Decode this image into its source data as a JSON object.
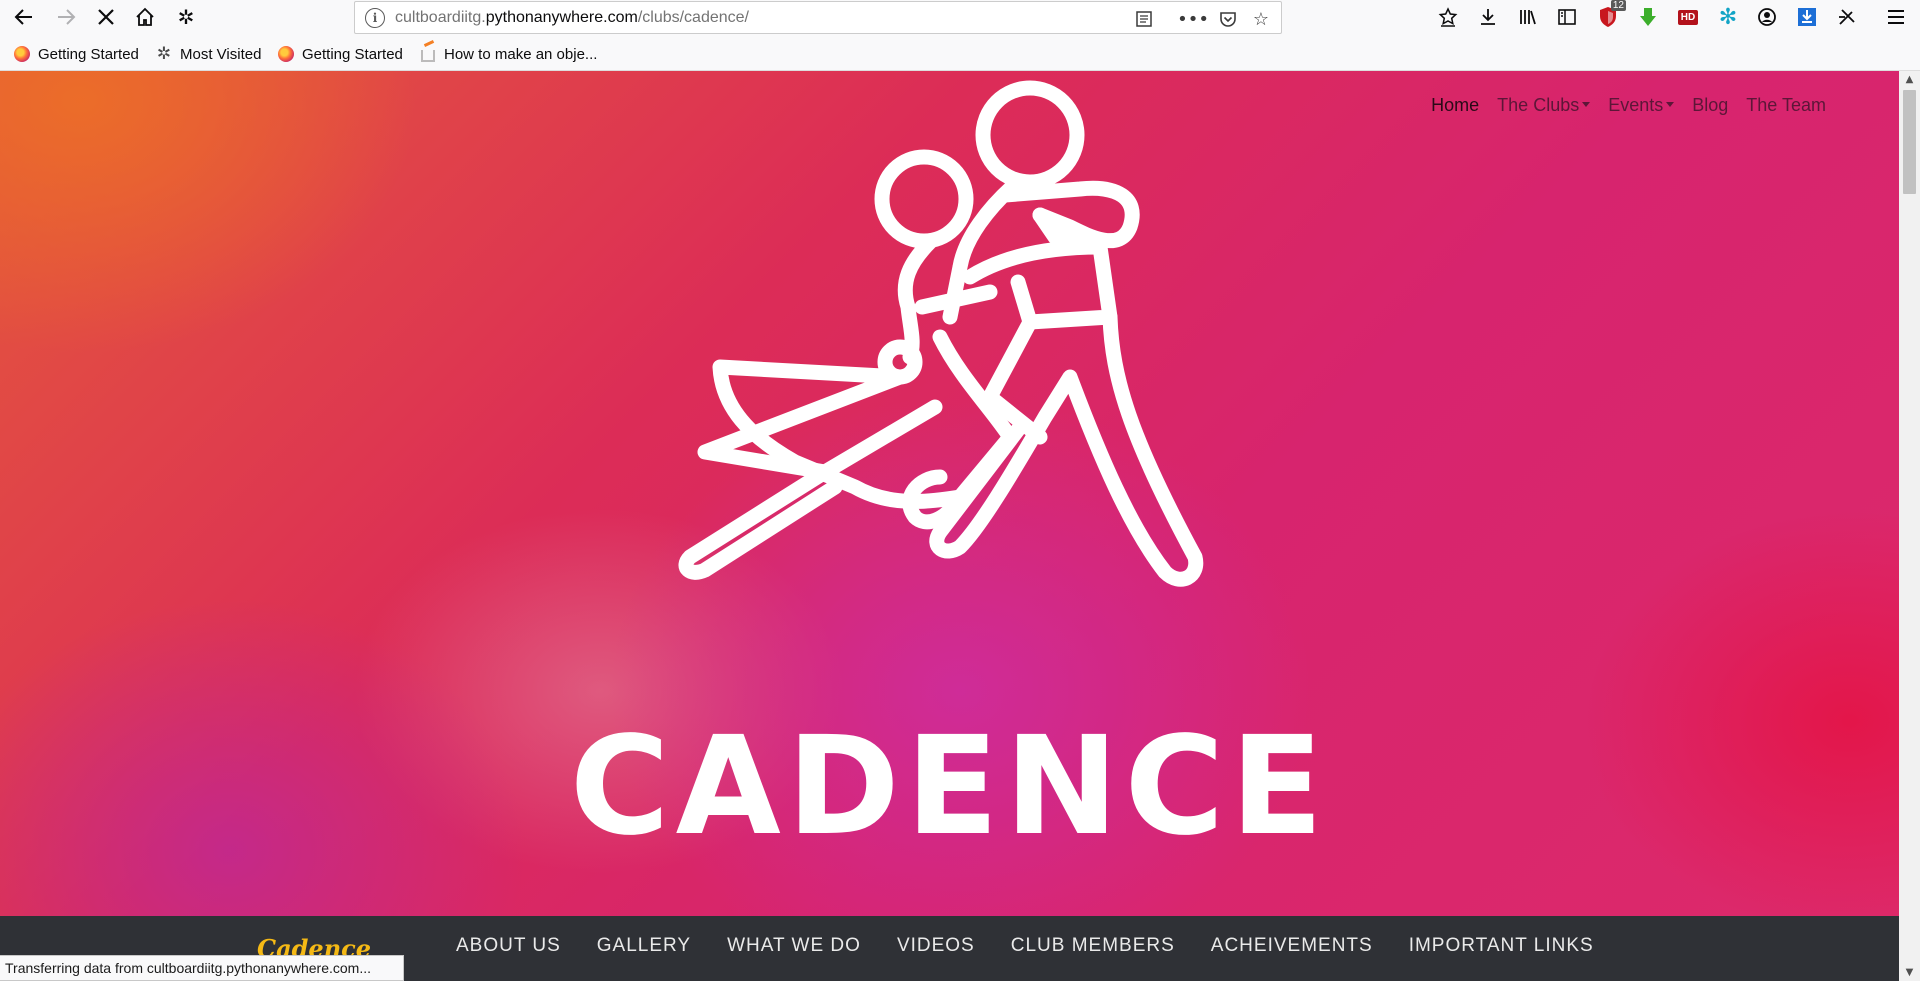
{
  "browser": {
    "url_prefix": "cultboardiitg.",
    "url_domain": "pythonanywhere.com",
    "url_path": "/clubs/cadence/",
    "badge_count": "12",
    "hd_label": "HD",
    "status_text": "Transferring data from cultboardiitg.pythonanywhere.com..."
  },
  "bookmarks": [
    {
      "label": "Getting Started",
      "icon": "firefox-icon"
    },
    {
      "label": "Most Visited",
      "icon": "gear-icon"
    },
    {
      "label": "Getting Started",
      "icon": "firefox-icon"
    },
    {
      "label": "How to make an obje...",
      "icon": "stackoverflow-icon"
    }
  ],
  "topnav": {
    "home": "Home",
    "clubs": "The Clubs",
    "events": "Events",
    "blog": "Blog",
    "team": "The Team"
  },
  "hero": {
    "title": "CADENCE"
  },
  "bottomnav": {
    "brand": "Cadence",
    "links": [
      "ABOUT US",
      "GALLERY",
      "WHAT WE DO",
      "VIDEOS",
      "CLUB MEMBERS",
      "ACHEIVEMENTS",
      "IMPORTANT LINKS"
    ]
  },
  "colors": {
    "brand_yellow": "#f5b915",
    "nav_dark": "#2f3136",
    "hero_pink": "#d7246e",
    "hero_orange": "#ec6e28"
  }
}
